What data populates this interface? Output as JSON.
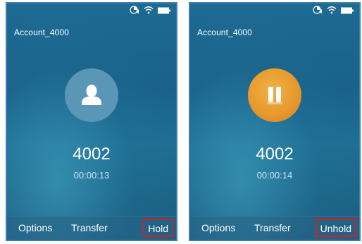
{
  "screens": [
    {
      "account": "Account_4000",
      "number": "4002",
      "timer": "00:00:13",
      "avatar_icon": "contact-icon",
      "softkeys": {
        "options": "Options",
        "transfer": "Transfer",
        "action": "Hold"
      }
    },
    {
      "account": "Account_4000",
      "number": "4002",
      "timer": "00:00:14",
      "avatar_icon": "pause-icon",
      "softkeys": {
        "options": "Options",
        "transfer": "Transfer",
        "action": "Unhold"
      }
    }
  ],
  "status_icons": [
    "signal-icon",
    "wifi-icon",
    "battery-icon"
  ],
  "colors": {
    "highlight": "#d61f1f",
    "hold_avatar": "#e79a2d",
    "contact_avatar": "#5a97b6",
    "screen_background": "#1d6a92"
  }
}
